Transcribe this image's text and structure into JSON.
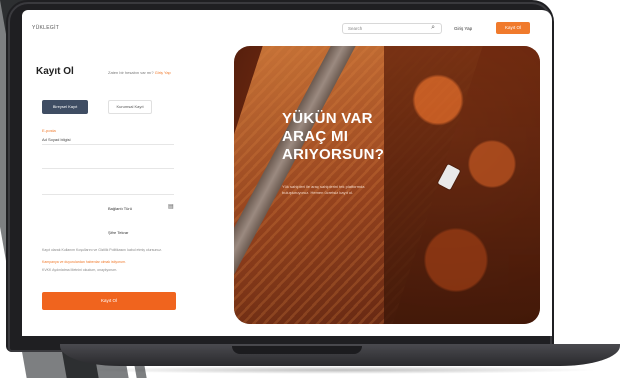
{
  "header": {
    "logo": "YÜKLEGİT",
    "search_placeholder": "Search",
    "login_label": "Giriş Yap",
    "signup_label": "Kayıt Ol"
  },
  "form": {
    "title": "Kayıt Ol",
    "have_account": "Zaten bir hesabın var mı?",
    "have_account_link": "Giriş Yap",
    "tab_individual": "Bireysel Kayıt",
    "tab_corporate": "Kurumsal Kayıt",
    "field1_label": "E-posta",
    "field1_value": "Ad Soyad bilgisi",
    "select_label_1": "Bağlantı Türü",
    "select_label_2": "Şifre Tekrar",
    "terms_line1": "Kayıt olarak Kullanım Koşullarını ve Gizlilik Politikasını kabul etmiş olursunuz.",
    "terms_line2": "Kampanya ve duyurulardan haberdar olmak istiyorum.",
    "terms_line3": "KVKK Aydınlatma Metnini okudum, onaylıyorum.",
    "submit_label": "Kayıt Ol"
  },
  "hero": {
    "title_line1": "YÜKÜN VAR",
    "title_line2": "ARAÇ MI",
    "title_line3": "ARIYORSUN?",
    "subtitle": "Yük sahipleri ile araç sahiplerini tek platformda buluşturuyoruz. Hemen ücretsiz kayıt ol."
  }
}
